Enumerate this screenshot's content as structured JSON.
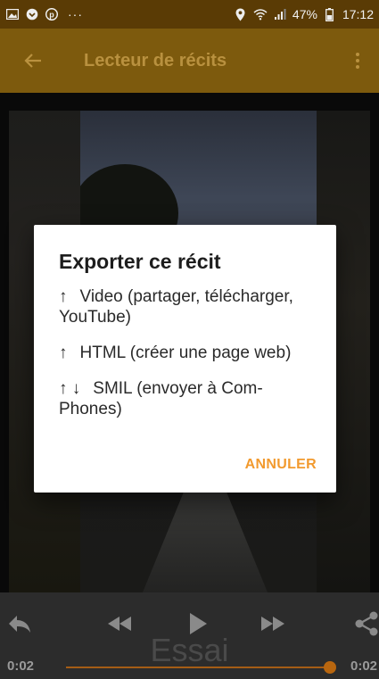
{
  "status_bar": {
    "icons_left": [
      "image-icon",
      "chat-bubble-icon",
      "pinterest-icon"
    ],
    "overflow_dots": "···",
    "battery_percent": "47%",
    "time": "17:12"
  },
  "app_bar": {
    "title": "Lecteur de récits"
  },
  "dialog": {
    "title": "Exporter ce récit",
    "options": [
      {
        "arrows": "↑",
        "label": "Video (partager, télécharger, YouTube)"
      },
      {
        "arrows": "↑",
        "label": "HTML (créer une page web)"
      },
      {
        "arrows": "↑ ↓",
        "label": "SMIL (envoyer à Com-Phones)"
      }
    ],
    "cancel_label": "ANNULER",
    "accent_color": "#f29a2e"
  },
  "player": {
    "caption": "Essai",
    "elapsed": "0:02",
    "total": "0:02",
    "progress_fraction": 1.0
  },
  "colors": {
    "app_bar": "#7d5a0d",
    "status_bar": "#5a3b05",
    "accent": "#f29a2e"
  }
}
